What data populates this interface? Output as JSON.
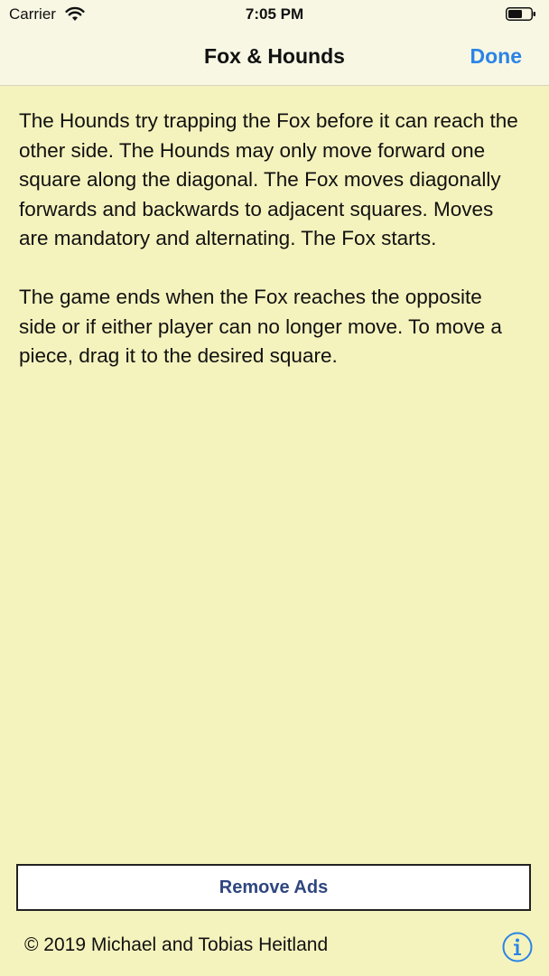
{
  "status_bar": {
    "carrier": "Carrier",
    "time": "7:05 PM",
    "icons": [
      "wifi-icon",
      "battery-icon"
    ]
  },
  "nav": {
    "title": "Fox & Hounds",
    "done_label": "Done"
  },
  "content": {
    "paragraphs": [
      "The Hounds try trapping the Fox before it can reach the other side. The Hounds may only move forward one square along the diagonal. The Fox moves diagonally forwards and backwards to adjacent squares. Moves are mandatory and alternating. The Fox starts.",
      "The game ends when the Fox reaches the opposite side or if either player can no longer move. To move a piece, drag it to the desired square."
    ]
  },
  "footer": {
    "remove_ads_label": "Remove Ads",
    "copyright": "© 2019 Michael and Tobias Heitland",
    "info_icon": "info-icon"
  },
  "colors": {
    "background": "#f5f3bd",
    "bar_background": "#f8f7e4",
    "accent": "#2a84e6",
    "button_text": "#2f4680"
  }
}
